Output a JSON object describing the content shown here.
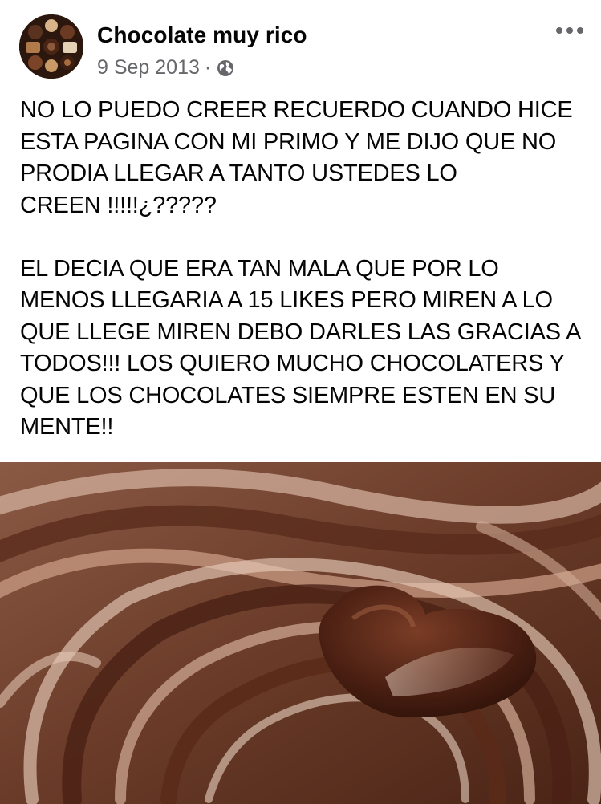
{
  "post": {
    "page_name": "Chocolate muy rico",
    "date": "9 Sep 2013",
    "separator": "·",
    "privacy_icon": "globe-icon",
    "more_icon": "more-options-icon",
    "more_label": "•••",
    "text": "NO LO PUEDO CREER RECUERDO CUANDO HICE\nESTA PAGINA CON MI PRIMO Y ME DIJO QUE NO\nPRODIA LLEGAR A TANTO USTEDES LO\nCREEN !!!!!¿?????\n\nEL DECIA QUE ERA TAN MALA QUE POR LO\nMENOS LLEGARIA A 15 LIKES PERO MIREN A LO\nQUE LLEGE MIREN DEBO DARLES LAS GRACIAS A\nTODOS!!! LOS QUIERO MUCHO CHOCOLATERS Y\nQUE LOS CHOCOLATES SIEMPRE ESTEN EN SU\nMENTE!!"
  },
  "colors": {
    "text": "#050505",
    "secondary_text": "#65676b",
    "chocolate_dark": "#3b1e12",
    "chocolate_mid": "#7a4a33",
    "chocolate_light": "#c9a08a"
  }
}
